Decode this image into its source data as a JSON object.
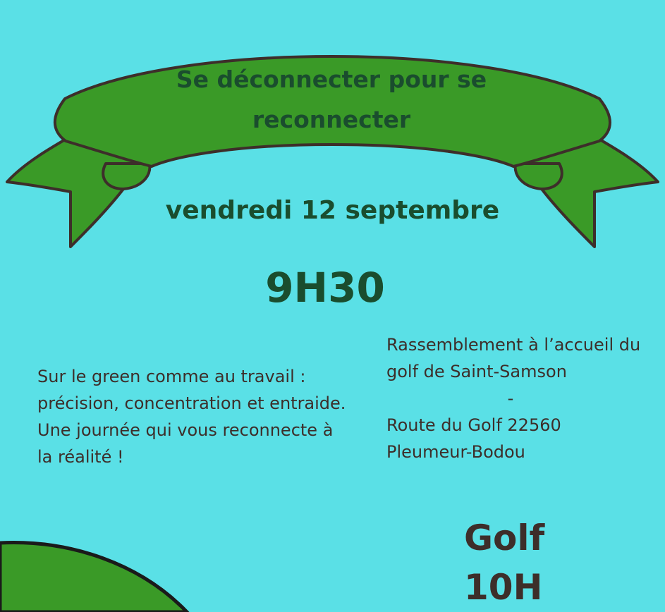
{
  "banner": {
    "title": "Se déconnecter pour se reconnecter",
    "ribbon_color": "#3a9a27",
    "outline_color": "#3d2e2a"
  },
  "event": {
    "date": "vendredi 12 septembre",
    "time": "9H30"
  },
  "description": "Sur le green comme au travail : précision, concentration et entraide. Une journée qui vous reconnecte à la réalité !",
  "location": {
    "line1": "Rassemblement à l’accueil du golf de Saint-Samson",
    "separator": "-",
    "line2": "Route du Golf 22560 Pleumeur-Bodou"
  },
  "activity": {
    "name": "Golf",
    "time": "10H"
  },
  "colors": {
    "background": "#5ae0e6",
    "heading_text": "#1a4d2e",
    "body_text": "#3d2e2a",
    "green": "#3a9a27"
  }
}
